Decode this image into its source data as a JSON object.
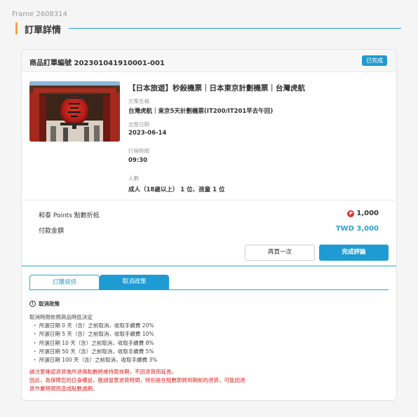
{
  "frame_label": "Frame 2608314",
  "section_title": "訂單詳情",
  "order": {
    "number_text": "商品訂單編號 20230104191000​1-001",
    "status_badge": "已完成"
  },
  "product": {
    "title": "【日本旅遊】秒殺機票｜日本東京計劃機票｜台灣虎航",
    "plan_label": "方案名稱",
    "plan_value": "台灣虎航｜東京5天計劃機票(IT200/IT201早去午回)",
    "depart_label": "出發日期",
    "depart_value": "2023-06-14",
    "time_label": "行程時間",
    "time_value": "09:30",
    "people_label": "人數",
    "people_value": "成人（18歲以上） 1 位、孩童 1 位"
  },
  "payment": {
    "points_label": "和泰 Points 點數折抵",
    "points_icon": "P",
    "points_value": "1,000",
    "total_label": "付款金額",
    "total_value": "TWD 3,000"
  },
  "actions": {
    "buy_again": "再買一次",
    "review": "完成評論"
  },
  "tabs": {
    "order_info": "訂購資訊",
    "cancel_policy": "取消政策"
  },
  "policy": {
    "heading": "取消政策",
    "intro": "取消時間依照商品時區決定",
    "items": [
      "・ 所選日期 0 天（含）之前取消，收取手續費 20%",
      "・ 所選日期 5 天（含）之前取消，收取手續費 10%",
      "・ 所選日期 10 天（含）之前取消，收取手續費 8%",
      "・ 所選日期 50 天（含）之前取消，收取手續費 5%",
      "・ 所選日期 100 天（含）之前取消，收取手續費 3%"
    ],
    "warnings": [
      "請注意確認退貨後所退換點數將維持原效期，不因退貨而延長。",
      "因此，為保障您的自身權益，敬請留意退貨時間，特別是在點數即將到期前的退貨，可能因退",
      "貨作業時間而造成點數過期。"
    ]
  },
  "colors": {
    "accent": "#1f9bd3",
    "section_marker": "#f0a23b",
    "points_icon": "#d9312b",
    "warning_text": "#e02020"
  }
}
